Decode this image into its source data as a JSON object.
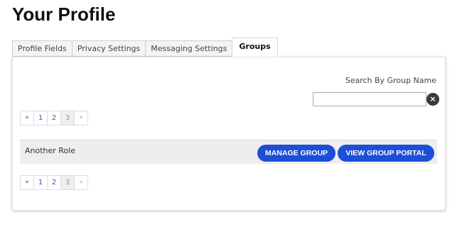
{
  "page": {
    "title": "Your Profile"
  },
  "tabs": [
    {
      "label": "Profile Fields",
      "active": false
    },
    {
      "label": "Privacy Settings",
      "active": false
    },
    {
      "label": "Messaging Settings",
      "active": false
    },
    {
      "label": "Groups",
      "active": true
    }
  ],
  "search": {
    "label": "Search By Group Name",
    "value": "",
    "placeholder": "",
    "clear_icon": "×"
  },
  "pagination": {
    "prev": "«",
    "next": "»",
    "pages": [
      "1",
      "2",
      "3"
    ],
    "current_page": "3"
  },
  "groups": [
    {
      "name": "Another Role",
      "manage_label": "MANAGE GROUP",
      "portal_label": "VIEW GROUP PORTAL"
    }
  ],
  "colors": {
    "accent": "#1d4fd6",
    "link": "#2a5bd7",
    "row_background": "#eeeeee"
  }
}
